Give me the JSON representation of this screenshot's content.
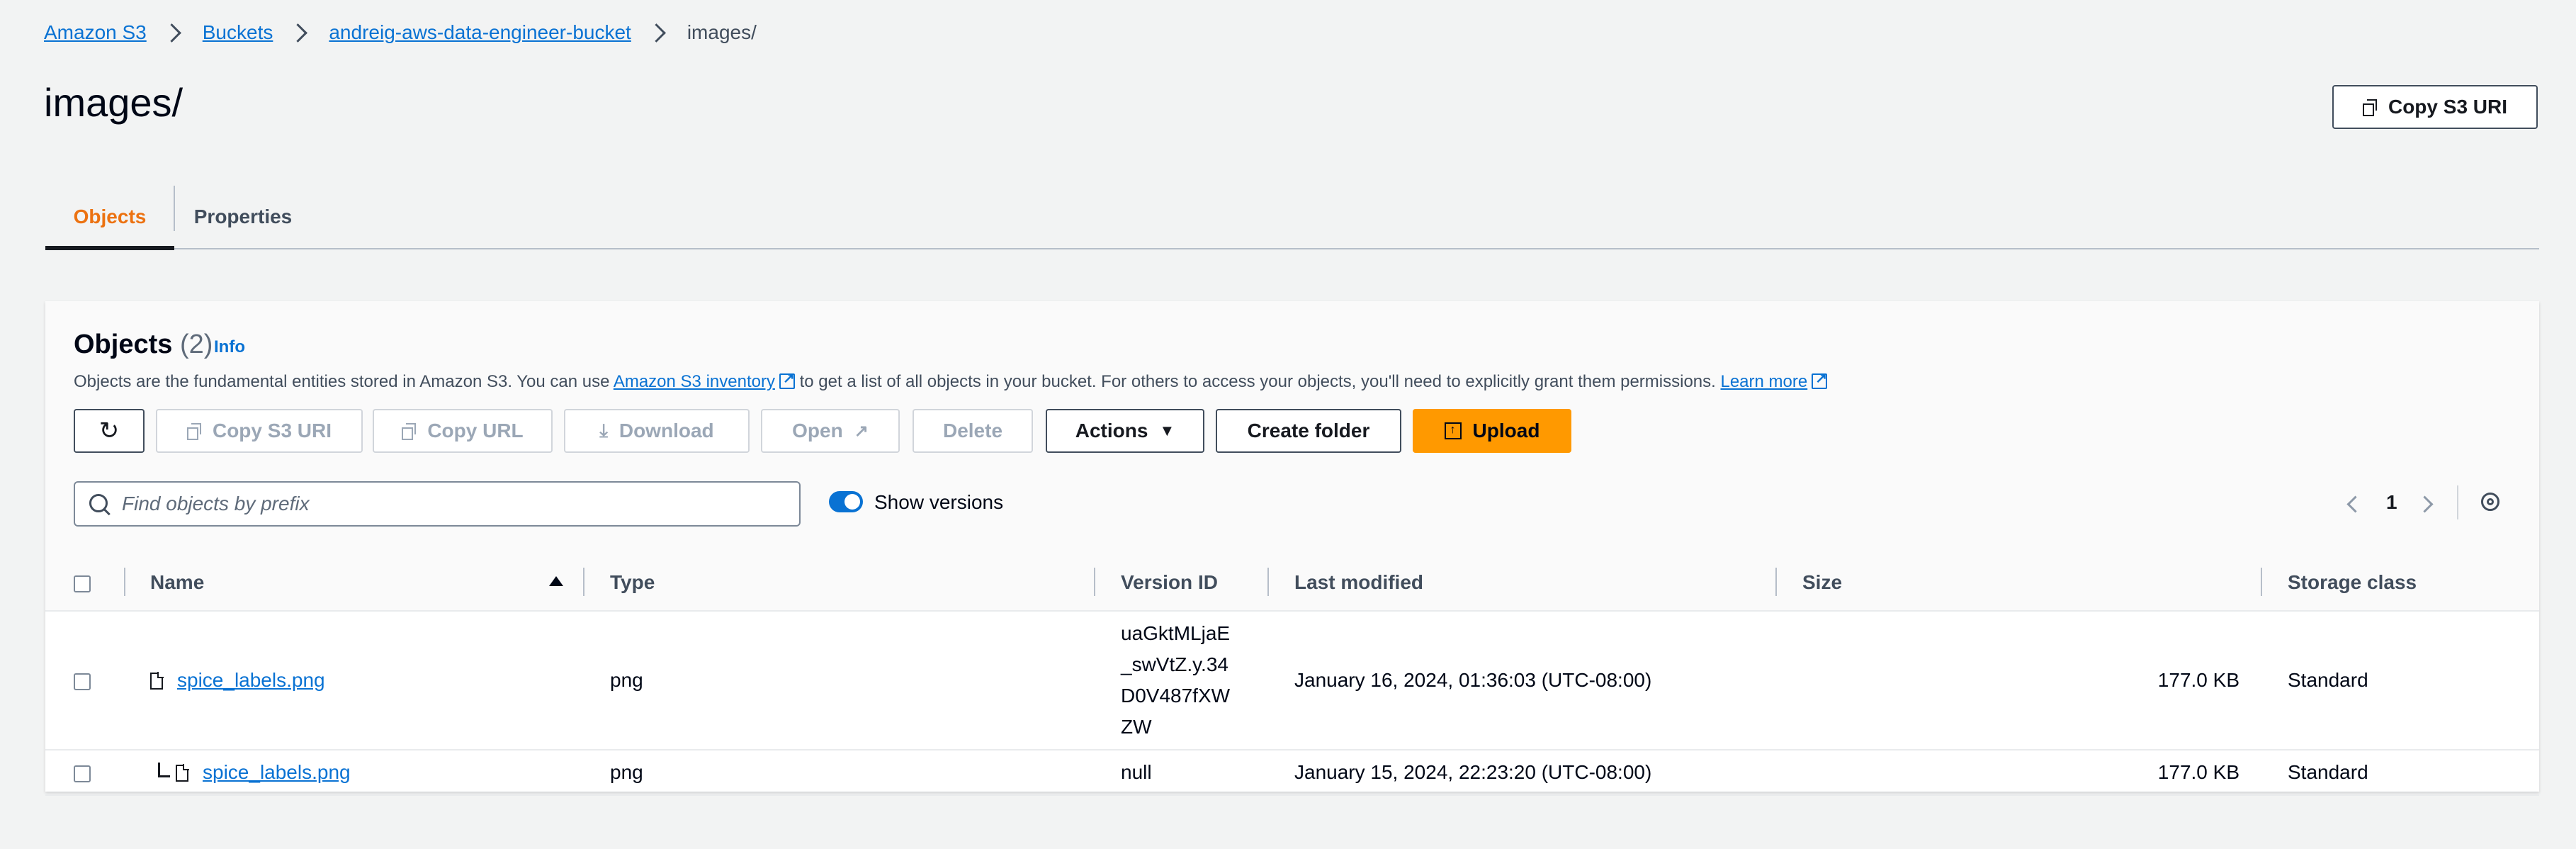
{
  "breadcrumb": {
    "items": [
      "Amazon S3",
      "Buckets",
      "andreig-aws-data-engineer-bucket"
    ],
    "current": "images/"
  },
  "page": {
    "title": "images/",
    "copy_uri_label": "Copy S3 URI"
  },
  "tabs": [
    {
      "label": "Objects",
      "active": true
    },
    {
      "label": "Properties",
      "active": false
    }
  ],
  "objects": {
    "heading": "Objects",
    "count": "(2)",
    "info_label": "Info",
    "description": {
      "before": "Objects are the fundamental entities stored in Amazon S3. You can use ",
      "inventory_link": "Amazon S3 inventory",
      "middle": " to get a list of all objects in your bucket. For others to access your objects, you'll need to explicitly grant them permissions. ",
      "learn_more": "Learn more"
    },
    "toolbar": {
      "copy_s3_uri": "Copy S3 URI",
      "copy_url": "Copy URL",
      "download": "Download",
      "open": "Open",
      "delete": "Delete",
      "actions": "Actions",
      "create_folder": "Create folder",
      "upload": "Upload"
    },
    "search_placeholder": "Find objects by prefix",
    "show_versions_label": "Show versions",
    "show_versions_on": true,
    "page_number": "1",
    "columns": [
      "Name",
      "Type",
      "Version ID",
      "Last modified",
      "Size",
      "Storage class"
    ],
    "rows": [
      {
        "name": "spice_labels.png",
        "type": "png",
        "version_id_lines": [
          "uaGktMLjaE",
          "_swVtZ.y.34",
          "D0V487fXW",
          "ZW"
        ],
        "last_modified": "January 16, 2024, 01:36:03 (UTC-08:00)",
        "size": "177.0 KB",
        "storage_class": "Standard"
      },
      {
        "name": "spice_labels.png",
        "type": "png",
        "version_id": "null",
        "last_modified": "January 15, 2024, 22:23:20 (UTC-08:00)",
        "size": "177.0 KB",
        "storage_class": "Standard"
      }
    ]
  },
  "colors": {
    "link": "#0972d3",
    "accent": "#ec7211",
    "primary_button": "#ff9900"
  }
}
